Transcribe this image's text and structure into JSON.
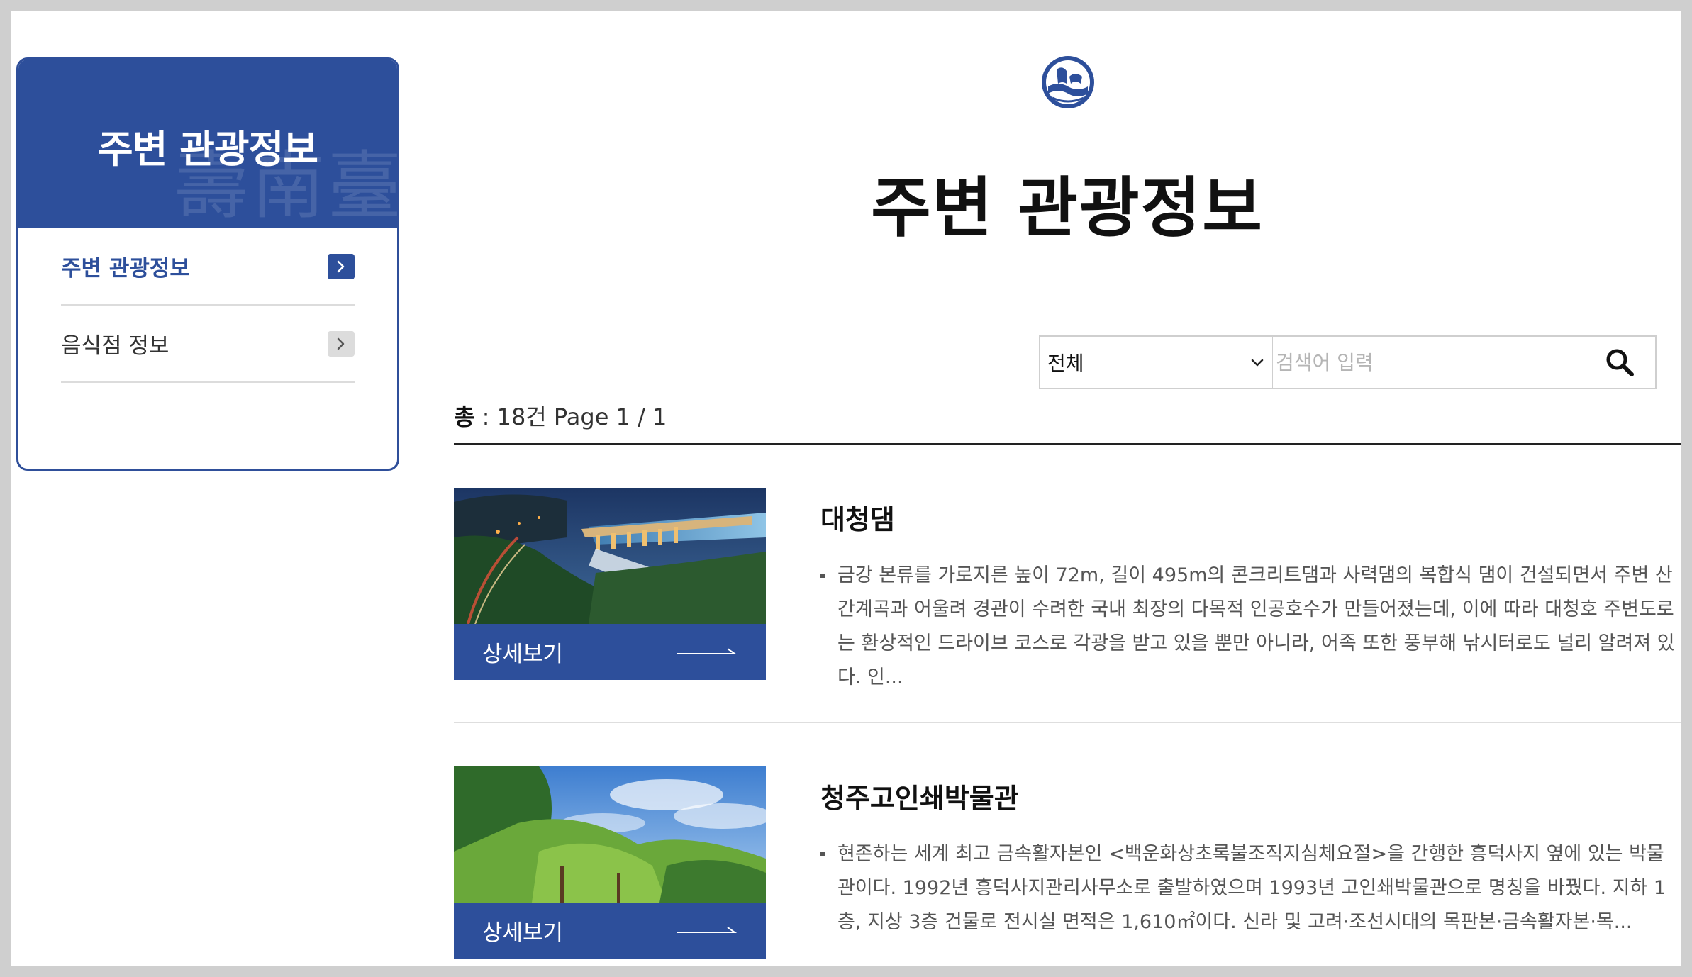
{
  "sidebar": {
    "title": "주변 관광정보",
    "watermark": "壽南臺",
    "items": [
      {
        "label": "주변 관광정보",
        "active": true
      },
      {
        "label": "음식점 정보",
        "active": false
      }
    ]
  },
  "page": {
    "title": "주변 관광정보"
  },
  "search": {
    "category_value": "전체",
    "placeholder": "검색어 입력",
    "value": ""
  },
  "summary": {
    "total_label": "총",
    "total_value": " : 18건 Page 1 / 1"
  },
  "items": [
    {
      "title": "대청댐",
      "detail_label": "상세보기",
      "description": "금강 본류를 가로지른 높이 72m, 길이 495m의 콘크리트댐과 사력댐의 복합식 댐이 건설되면서 주변 산간계곡과 어울려 경관이 수려한 국내 최장의 다목적 인공호수가 만들어졌는데, 이에 따라 대청호 주변도로는 환상적인 드라이브 코스로 각광을 받고 있을 뿐만 아니라, 어족 또한 풍부해 낚시터로도 널리 알려져 있다. 인..."
    },
    {
      "title": "청주고인쇄박물관",
      "detail_label": "상세보기",
      "description": "현존하는 세계 최고 금속활자본인 <백운화상초록불조직지심체요절>을 간행한 흥덕사지 옆에 있는 박물관이다. 1992년 흥덕사지관리사무소로 출발하였으며 1993년 고인쇄박물관으로 명칭을 바꿨다. 지하 1층, 지상 3층 건물로 전시실 면적은 1,610㎡이다. 신라 및 고려·조선시대의 목판본·금속활자본·목..."
    }
  ],
  "colors": {
    "primary": "#2d4f9b",
    "text_dark": "#111111",
    "text_body": "#555555",
    "border": "#cfcfcf"
  },
  "icons": {
    "logo": "emblem-logo",
    "chevron": "chevron-right-icon",
    "dropdown": "chevron-down-icon",
    "search": "search-icon",
    "arrow": "long-arrow-right-icon"
  }
}
